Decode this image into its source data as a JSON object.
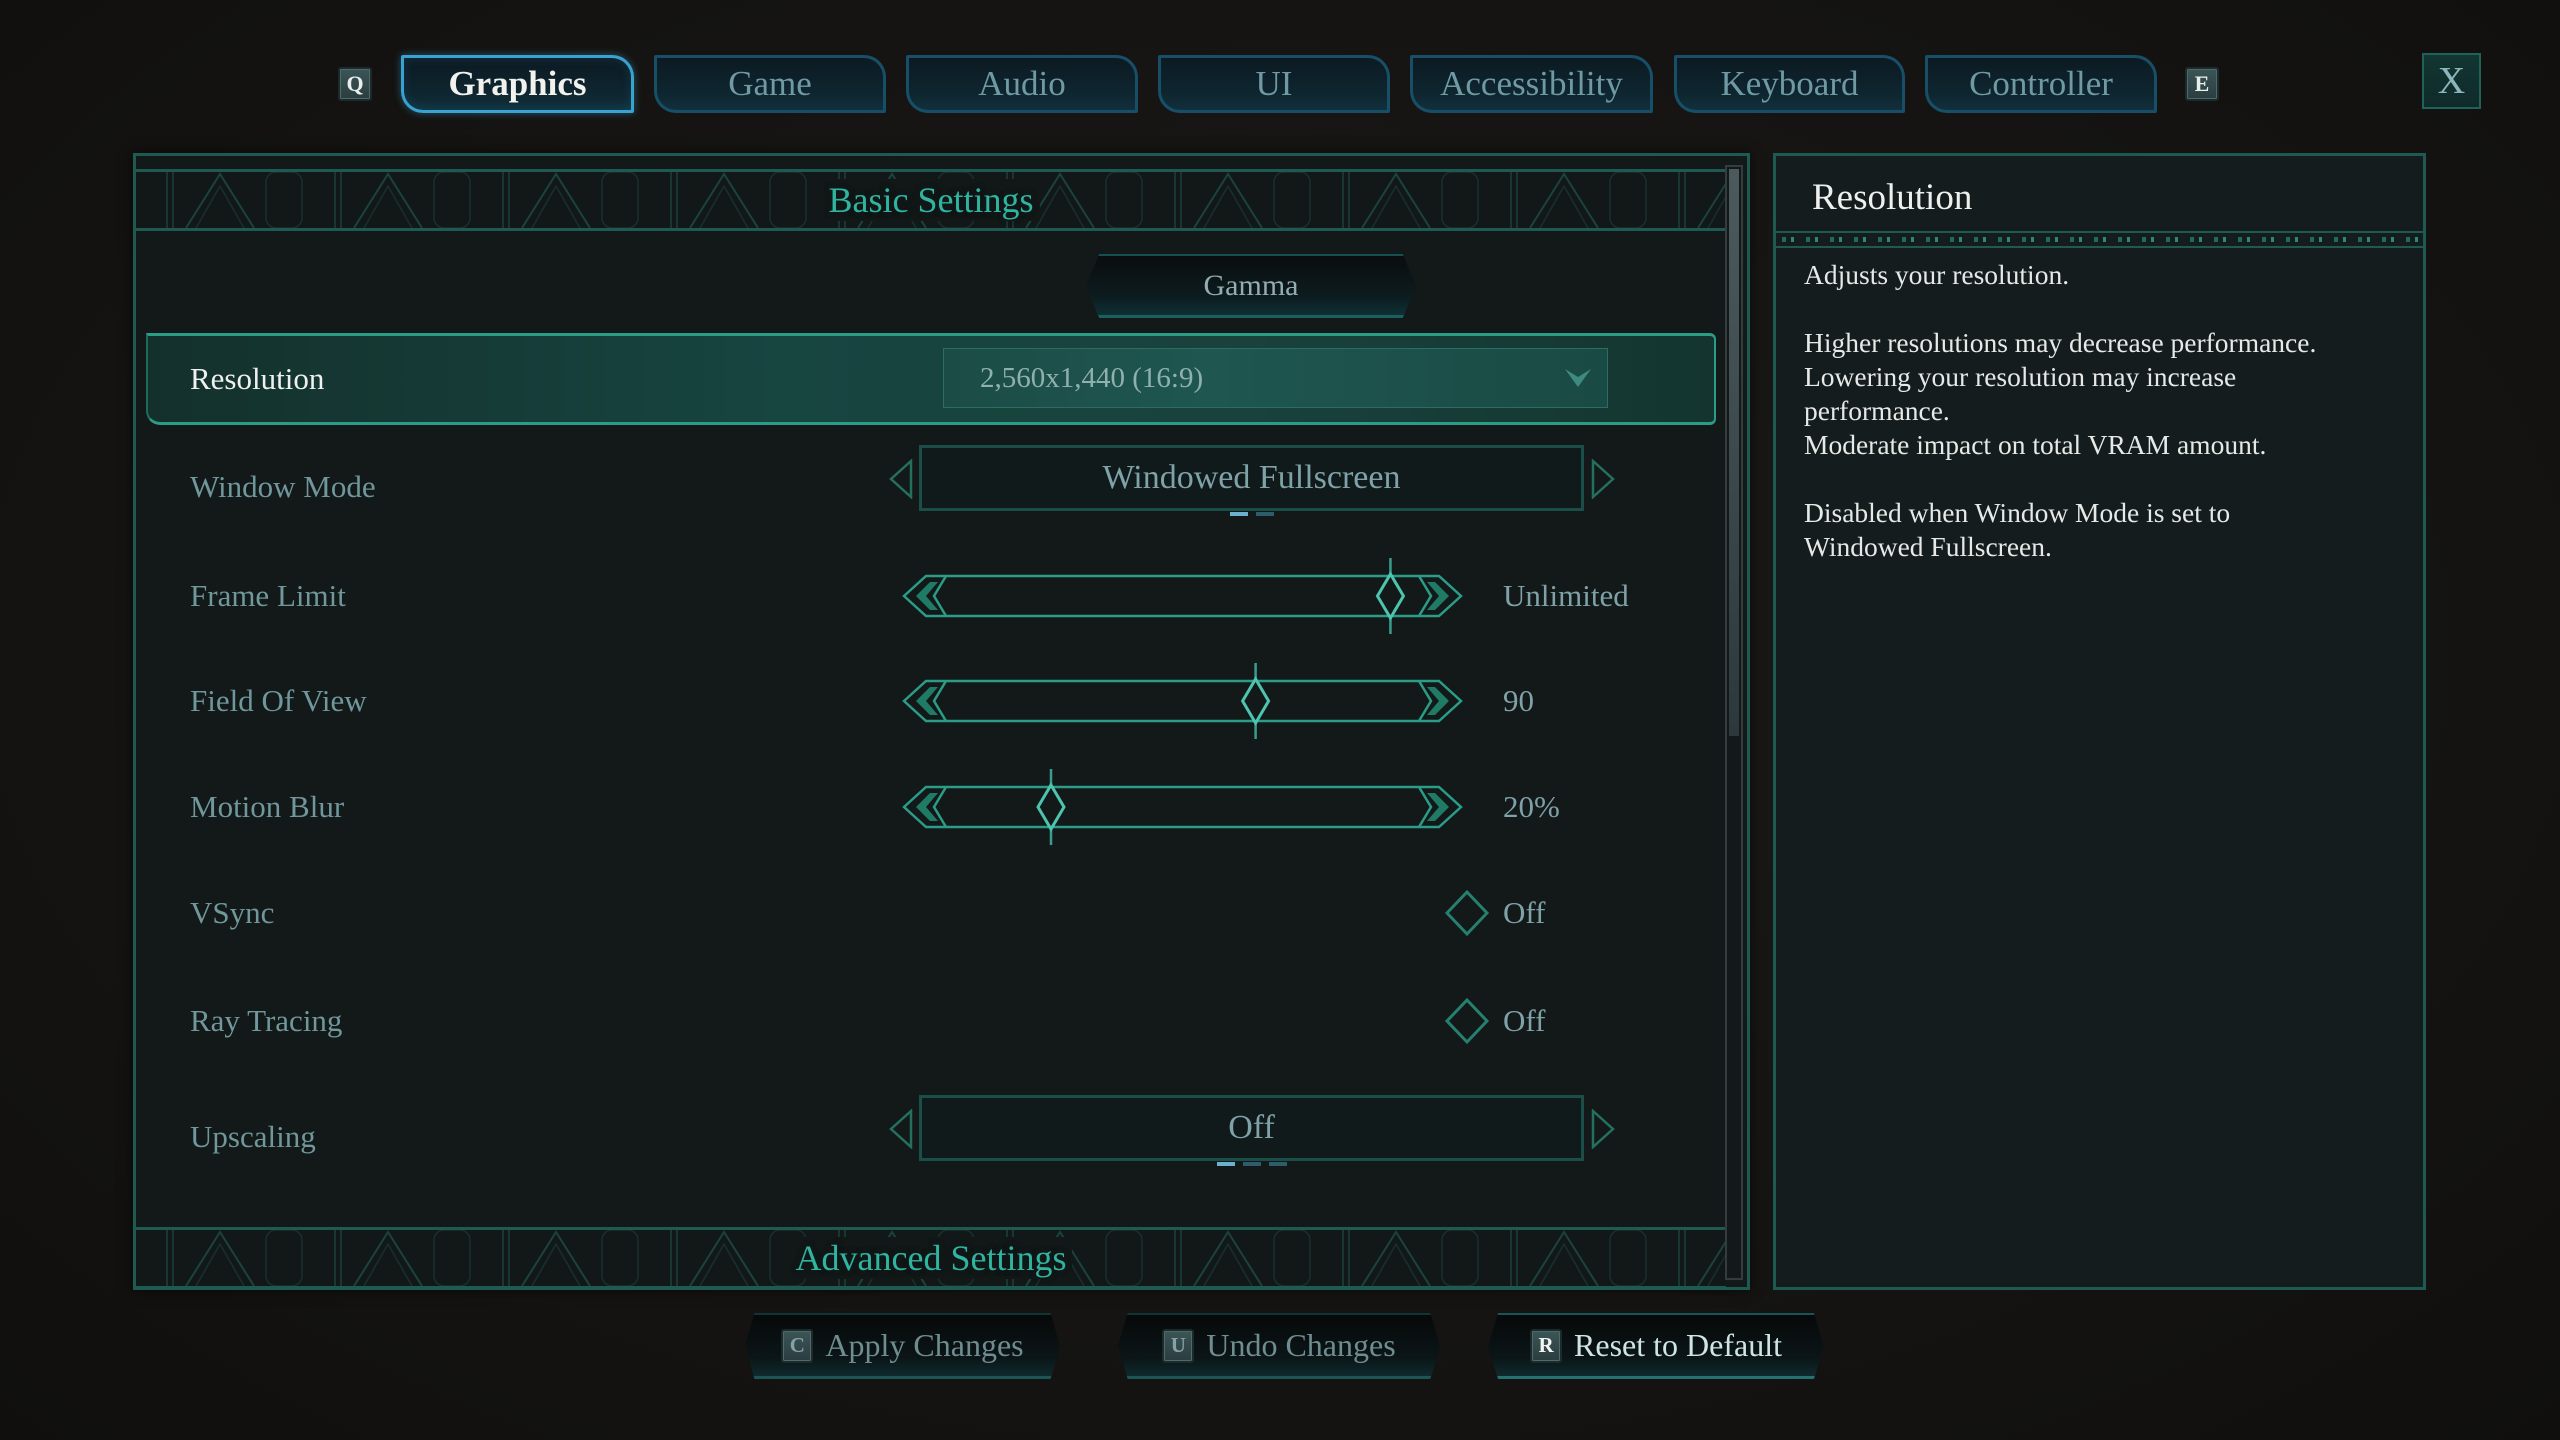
{
  "tabs": {
    "prev_key": "Q",
    "next_key": "E",
    "items": [
      {
        "label": "Graphics",
        "active": true
      },
      {
        "label": "Game",
        "active": false
      },
      {
        "label": "Audio",
        "active": false
      },
      {
        "label": "UI",
        "active": false
      },
      {
        "label": "Accessibility",
        "active": false
      },
      {
        "label": "Keyboard",
        "active": false
      },
      {
        "label": "Controller",
        "active": false
      }
    ],
    "close_label": "X"
  },
  "settings": {
    "basic_header": "Basic Settings",
    "advanced_header": "Advanced Settings",
    "gamma_button": "Gamma",
    "scroll_fraction_visible": 0.51,
    "scroll_position": 0.0,
    "resolution": {
      "label": "Resolution",
      "value": "2,560x1,440 (16:9)",
      "selected": true
    },
    "window_mode": {
      "label": "Window Mode",
      "value": "Windowed Fullscreen",
      "option_index": 0,
      "option_count": 2
    },
    "frame_limit": {
      "label": "Frame Limit",
      "value": "Unlimited",
      "slider_fraction": 0.93
    },
    "field_of_view": {
      "label": "Field Of View",
      "value": "90",
      "slider_fraction": 0.64
    },
    "motion_blur": {
      "label": "Motion Blur",
      "value": "20%",
      "slider_fraction": 0.2
    },
    "vsync": {
      "label": "VSync",
      "value": "Off"
    },
    "ray_tracing": {
      "label": "Ray Tracing",
      "value": "Off"
    },
    "upscaling": {
      "label": "Upscaling",
      "value": "Off",
      "option_index": 0,
      "option_count": 3
    }
  },
  "info_panel": {
    "title": "Resolution",
    "paragraphs": [
      [
        "Adjusts your resolution."
      ],
      [
        "Higher resolutions may decrease performance.",
        "Lowering your resolution may increase",
        "performance.",
        "Moderate impact on total VRAM amount."
      ],
      [
        "Disabled when Window Mode is set to",
        "Windowed Fullscreen."
      ]
    ]
  },
  "footer": {
    "apply": {
      "key": "C",
      "label": "Apply Changes"
    },
    "undo": {
      "key": "U",
      "label": "Undo Changes"
    },
    "reset": {
      "key": "R",
      "label": "Reset to Default"
    }
  },
  "colors": {
    "accent_teal": "#2fb4a0",
    "tab_active_border": "#3aa2d0",
    "panel_border": "#1d5a52",
    "slider_line": "#2a9c88"
  }
}
